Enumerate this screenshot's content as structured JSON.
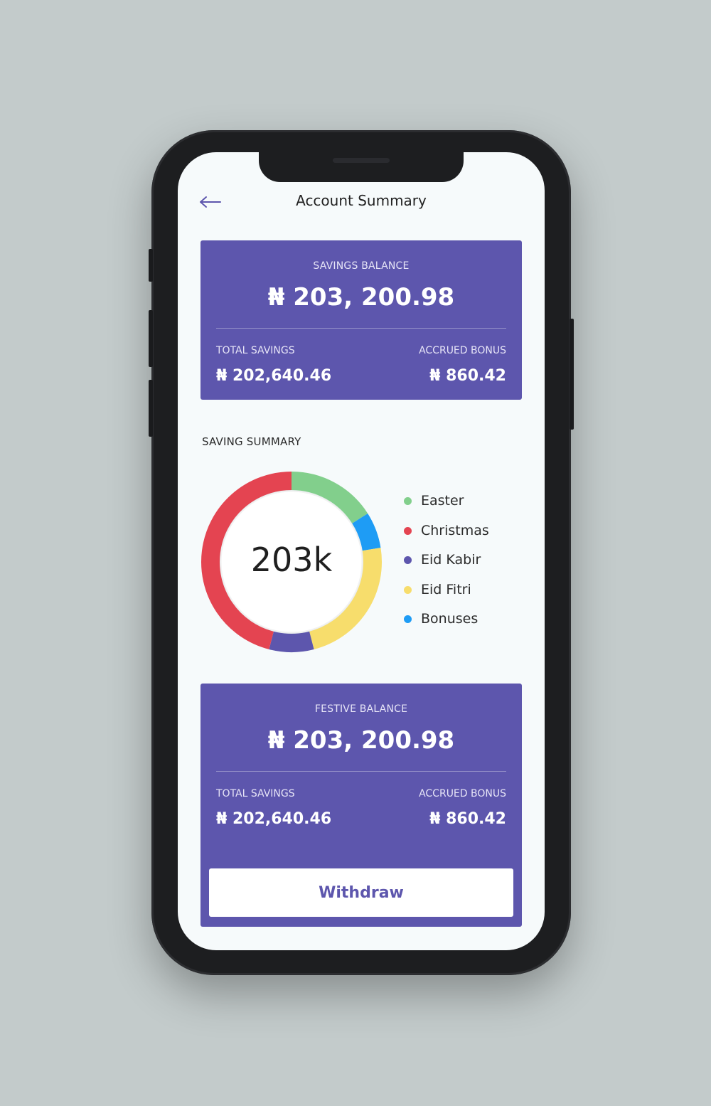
{
  "header": {
    "title": "Account Summary",
    "back_icon": "back-arrow-icon"
  },
  "savings_card": {
    "label": "SAVINGS BALANCE",
    "amount": "₦ 203, 200.98",
    "total_savings_label": "TOTAL SAVINGS",
    "total_savings_value": "₦ 202,640.46",
    "accrued_bonus_label": "ACCRUED BONUS",
    "accrued_bonus_value": "₦ 860.42"
  },
  "saving_summary": {
    "title": "SAVING SUMMARY",
    "center_text": "203k",
    "legend": [
      {
        "label": "Easter",
        "color": "#82cf8c"
      },
      {
        "label": "Christmas",
        "color": "#e44451"
      },
      {
        "label": "Eid Kabir",
        "color": "#5d56ad"
      },
      {
        "label": "Eid Fitri",
        "color": "#f7dd6c"
      },
      {
        "label": "Bonuses",
        "color": "#1e9cf5"
      }
    ]
  },
  "chart_data": {
    "type": "pie",
    "center_label": "203k",
    "categories": [
      "Easter",
      "Bonuses",
      "Eid Fitri",
      "Eid Kabir",
      "Christmas"
    ],
    "values": [
      16,
      6.5,
      23.5,
      8,
      46
    ],
    "colors": [
      "#82cf8c",
      "#1e9cf5",
      "#f7dd6c",
      "#5d56ad",
      "#e44451"
    ]
  },
  "festive_card": {
    "label": "FESTIVE BALANCE",
    "amount": "₦ 203, 200.98",
    "total_savings_label": "TOTAL SAVINGS",
    "total_savings_value": "₦ 202,640.46",
    "accrued_bonus_label": "ACCRUED BONUS",
    "accrued_bonus_value": "₦ 860.42",
    "withdraw_label": "Withdraw"
  },
  "colors": {
    "accent": "#5d56ad",
    "background": "#c3cbcb",
    "screen": "#f6fafb"
  }
}
